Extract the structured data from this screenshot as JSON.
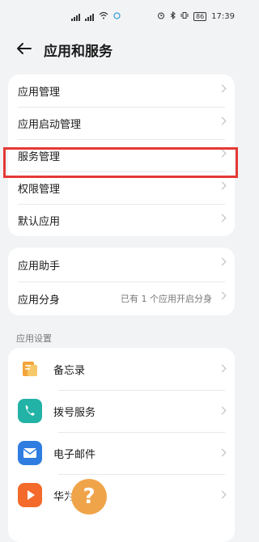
{
  "status": {
    "time": "17:39",
    "battery": "86"
  },
  "header": {
    "title": "应用和服务"
  },
  "group1": [
    {
      "label": "应用管理"
    },
    {
      "label": "应用启动管理"
    },
    {
      "label": "服务管理"
    },
    {
      "label": "权限管理"
    },
    {
      "label": "默认应用"
    }
  ],
  "group2": [
    {
      "label": "应用助手",
      "value": ""
    },
    {
      "label": "应用分身",
      "value": "已有 1 个应用开启分身"
    }
  ],
  "section": {
    "label": "应用设置"
  },
  "apps": [
    {
      "label": "备忘录",
      "icon": "memo-icon",
      "color": "#f3a43b"
    },
    {
      "label": "拨号服务",
      "icon": "phone-icon",
      "color": "#22b3a6"
    },
    {
      "label": "电子邮件",
      "icon": "email-icon",
      "color": "#2f7de1"
    },
    {
      "label": "华为视频",
      "icon": "video-icon",
      "color": "#f36a2a"
    }
  ],
  "help": {
    "symbol": "?"
  },
  "colors": {
    "highlight": "#e53935",
    "background": "#f1f3f5"
  }
}
